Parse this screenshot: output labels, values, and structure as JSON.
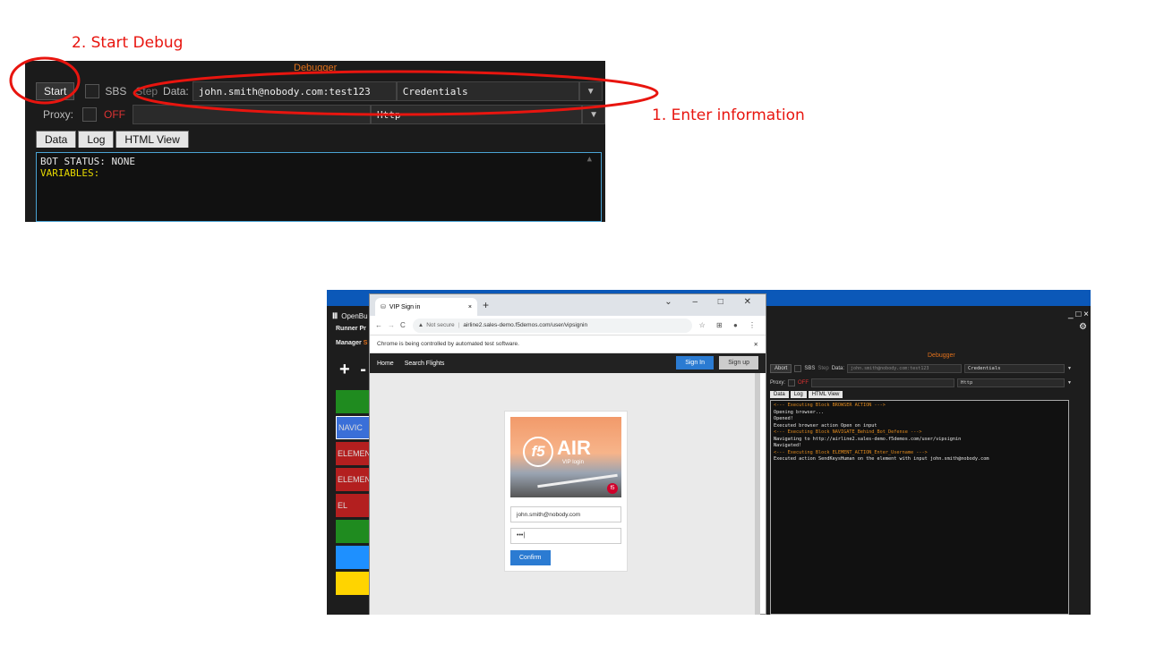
{
  "annotations": {
    "start_debug": "2. Start Debug",
    "enter_information": "1. Enter information"
  },
  "top_debugger": {
    "title": "Debugger",
    "start_label": "Start",
    "sbs_label": "SBS",
    "step_label": "Step",
    "data_label": "Data:",
    "data_value": "john.smith@nobody.com:test123",
    "type_value": "Credentials",
    "proxy_label": "Proxy:",
    "proxy_state": "OFF",
    "proxy_type": "Http",
    "tabs": [
      "Data",
      "Log",
      "HTML View"
    ],
    "bot_status": "BOT STATUS: NONE",
    "variables": "VARIABLES:"
  },
  "left_app": {
    "title": "OpenBu",
    "menu1": "Runner",
    "menu2": "Pr",
    "menu3": "Manager",
    "menu4": "S",
    "plus": "+",
    "minus": "-",
    "blocks": [
      {
        "label": "",
        "color": "#1f8b1f"
      },
      {
        "label": "NAVIC",
        "color": "#3a6fd8"
      },
      {
        "label": "ELEMEN",
        "color": "#b31f1f"
      },
      {
        "label": "ELEMEN",
        "color": "#b31f1f"
      },
      {
        "label": "EL",
        "color": "#b31f1f"
      },
      {
        "label": "",
        "color": "#1f8b1f"
      },
      {
        "label": "",
        "color": "#1e90ff"
      },
      {
        "label": "",
        "color": "#ffd400"
      }
    ]
  },
  "browser": {
    "tab_title": "VIP Sign in",
    "tab_close": "×",
    "new_tab": "+",
    "not_secure": "Not secure",
    "url": "airline2.sales-demo.f5demos.com/user/vipsignin",
    "automation_notice": "Chrome is being controlled by automated test software.",
    "nav_home": "Home",
    "nav_search": "Search Flights",
    "sign_in": "Sign In",
    "sign_up": "Sign up",
    "logo_text": "AIR",
    "logo_badge": "f5",
    "logo_sub": "VIP login",
    "username_value": "john.smith@nobody.com",
    "password_value": "•••|",
    "confirm_label": "Confirm"
  },
  "right_debugger": {
    "title": "Debugger",
    "abort_label": "Abort",
    "sbs_label": "SBS",
    "step_label": "Step",
    "data_label": "Data:",
    "data_value": "john.smith@nobody.com:test123",
    "type_value": "Credentials",
    "proxy_label": "Proxy:",
    "proxy_state": "OFF",
    "proxy_type": "Http",
    "tabs": [
      "Data",
      "Log",
      "HTML View"
    ],
    "log": [
      {
        "text": "<--- Executing Block BROWSER ACTION --->",
        "color": "#e08a1e"
      },
      {
        "text": "Opening browser...",
        "color": "#e6e6e6"
      },
      {
        "text": "Opened!",
        "color": "#e6e6e6"
      },
      {
        "text": "Executed browser action Open on input",
        "color": "#e6e6e6"
      },
      {
        "text": "<--- Executing Block NAVIGATE_Behind_Bot_Defense --->",
        "color": "#e08a1e"
      },
      {
        "text": "Navigating to http://airline2.sales-demo.f5demos.com/user/vipsignin",
        "color": "#e6e6e6"
      },
      {
        "text": "Navigated!",
        "color": "#e6e6e6"
      },
      {
        "text": "<--- Executing Block ELEMENT_ACTION_Enter_Username --->",
        "color": "#e08a1e"
      },
      {
        "text": "Executed action SendKeysHuman on the element with input john.smith@nobody.com",
        "color": "#e6e6e6"
      }
    ],
    "window_controls": "_ □ ×"
  }
}
